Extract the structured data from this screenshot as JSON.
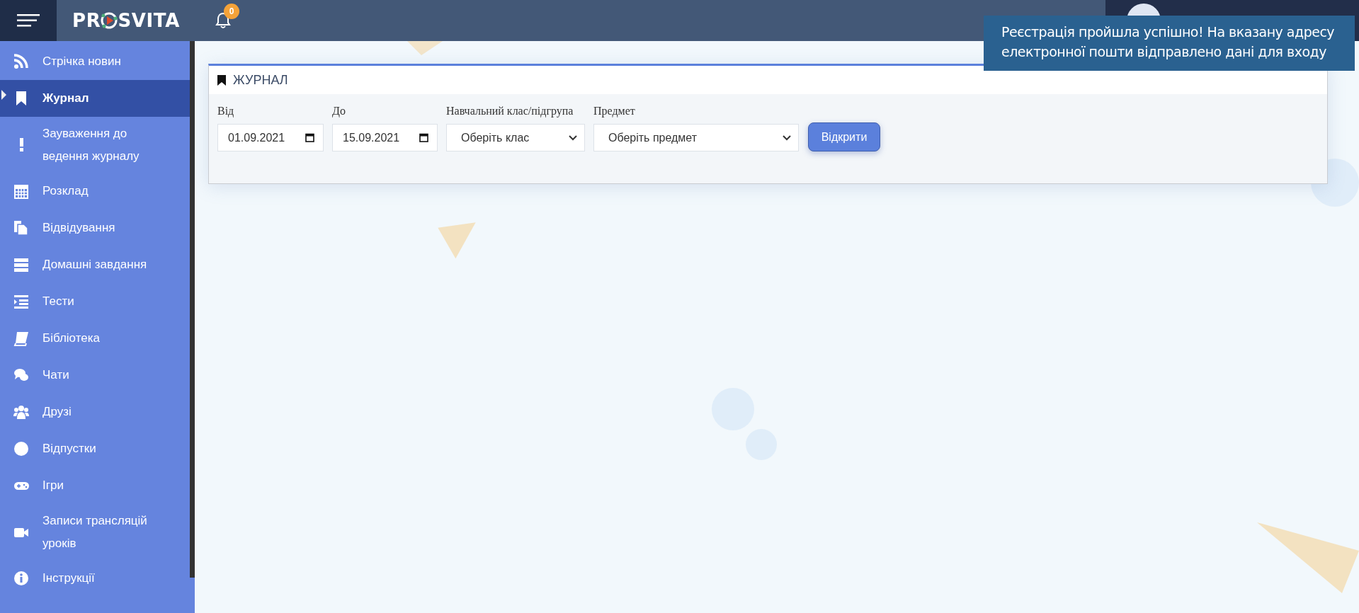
{
  "topbar": {
    "logo": {
      "left": "PR",
      "right": "SVITA"
    },
    "notifications": {
      "count": "0"
    }
  },
  "sidebar": {
    "items": [
      {
        "kind": "rss",
        "label": "Стрічка новин",
        "selected": false
      },
      {
        "kind": "bookmark",
        "label": "Журнал",
        "selected": true
      },
      {
        "kind": "exclamation",
        "label": "Зауваження до ведення журналу",
        "selected": false
      },
      {
        "kind": "calendar",
        "label": "Розклад",
        "selected": false
      },
      {
        "kind": "files",
        "label": "Відвідування",
        "selected": false
      },
      {
        "kind": "stack",
        "label": "Домашні завдання",
        "selected": false
      },
      {
        "kind": "list",
        "label": "Тести",
        "selected": false
      },
      {
        "kind": "book",
        "label": "Бібліотека",
        "selected": false
      },
      {
        "kind": "chat",
        "label": "Чати",
        "selected": false
      },
      {
        "kind": "users",
        "label": "Друзі",
        "selected": false
      },
      {
        "kind": "circle",
        "label": "Відпустки",
        "selected": false
      },
      {
        "kind": "gamepad",
        "label": "Ігри",
        "selected": false
      },
      {
        "kind": "video",
        "label": "Записи трансляцій уроків",
        "selected": false
      },
      {
        "kind": "info",
        "label": "Інструкції",
        "selected": false
      }
    ]
  },
  "card": {
    "title": "ЖУРНАЛ",
    "fields": [
      {
        "kind": "date",
        "label": "Від",
        "value": "01.09.2021"
      },
      {
        "kind": "date",
        "label": "До",
        "value": "15.09.2021"
      },
      {
        "kind": "select",
        "label": "Навчальний клас/підгрупа",
        "value": "Оберіть клас"
      },
      {
        "kind": "select",
        "label": "Предмет",
        "value": "Оберіть предмет"
      }
    ],
    "button": "Відкрити"
  },
  "toast": {
    "message": "Реєстрація пройшла успішно! На вказану адресу електронної пошти відправлено дані для входу"
  }
}
